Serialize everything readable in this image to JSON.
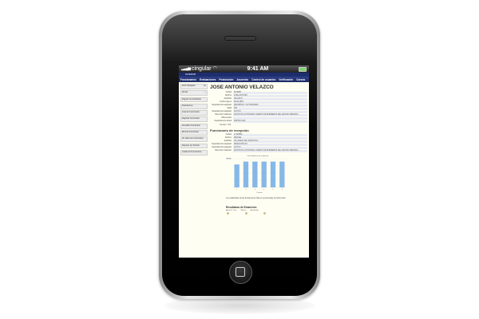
{
  "status": {
    "carrier": "cingular",
    "time": "9:41 AM"
  },
  "app": {
    "title": "SIVEDUR"
  },
  "nav": [
    "Funcionarios",
    "Evaluaciones",
    "Postulación",
    "Acuerdos",
    "Control de usuarios",
    "Verificación",
    "Cursos"
  ],
  "sidebar": [
    {
      "label": "Perfil Trabajador",
      "badge": "FAI"
    },
    {
      "label": "Alertas",
      "badge": "•••"
    },
    {
      "label": "Registro de Actividades",
      "badge": ""
    },
    {
      "label": "Evaluaciones",
      "badge": ""
    },
    {
      "label": "Lista de Funcionarios",
      "badge": ""
    },
    {
      "label": "Registrar Funcionario",
      "badge": ""
    },
    {
      "label": "Actualizar Funcionario",
      "badge": ""
    },
    {
      "label": "Eliminar Funcionario",
      "badge": ""
    },
    {
      "label": "Ver datos de Funcionarios",
      "badge": ""
    },
    {
      "label": "Reportes por Periodo",
      "badge": ""
    },
    {
      "label": "Listado de Funcionarios",
      "badge": ""
    }
  ],
  "main": {
    "name": "JOSE ANTONIO VELAZCO",
    "fields": [
      {
        "k": "Cédula",
        "v": "8978985"
      },
      {
        "k": "Nombre",
        "v": "JOSE ANTONIO"
      },
      {
        "k": "Apellidos",
        "v": "VELAZCO"
      },
      {
        "k": "Fecha Ingreso",
        "v": "99-09-1994"
      },
      {
        "k": "Departamento asignado",
        "v": "DEPORTES Y ACTIVIDADES"
      },
      {
        "k": "Edad",
        "v": "498"
      },
      {
        "k": "Departamento asignado",
        "v": "ACTIVO"
      },
      {
        "k": "Dirección Institución",
        "v": "INSTITUTO AUTÓNOMO CUERPO DE BOMBEROS DEL ESTADO MIRANDA"
      },
      {
        "k": "Observación",
        "v": ""
      },
      {
        "k": "Departamento actual",
        "v": "PARTICULAR"
      }
    ],
    "note": "Ventana: 7/32",
    "section2": "Funcionario de recepción",
    "fields2": [
      {
        "k": "Cédula",
        "v": "17423896"
      },
      {
        "k": "Nombre",
        "v": "MANUEL"
      },
      {
        "k": "Apellidos",
        "v": "VILLAREAL DEL MANCHALA"
      },
      {
        "k": "Departamento asignado",
        "v": "DIRECCIÓN SO"
      },
      {
        "k": "Departamento asignado",
        "v": "ACTIVO"
      },
      {
        "k": "Dirección Institución",
        "v": "INSTITUTO AUTÓNOMO CUERPO DE BOMBEROS DEL ESTADO MIRANDA"
      }
    ],
    "caption": "Los estadísticas de las fechas de los días en el porcentaje de 100 puntos",
    "results_title": "Resultados de Examenes",
    "results_labels": [
      "Aptitud / Vista",
      "Medico",
      "Aprobadas"
    ]
  },
  "colors": {
    "nav": "#1b2a66",
    "bars": "#85b8e8"
  },
  "chart_data": {
    "type": "bar",
    "title": "Datos Históricos de rendimiento",
    "categories": [
      "1",
      "2",
      "3",
      "4",
      "5",
      "6"
    ],
    "values": [
      80,
      90,
      90,
      90,
      90,
      90
    ],
    "ylim": [
      0,
      100
    ],
    "grid": true,
    "legend_tag": "Fecha",
    "xlabel": "Período"
  }
}
